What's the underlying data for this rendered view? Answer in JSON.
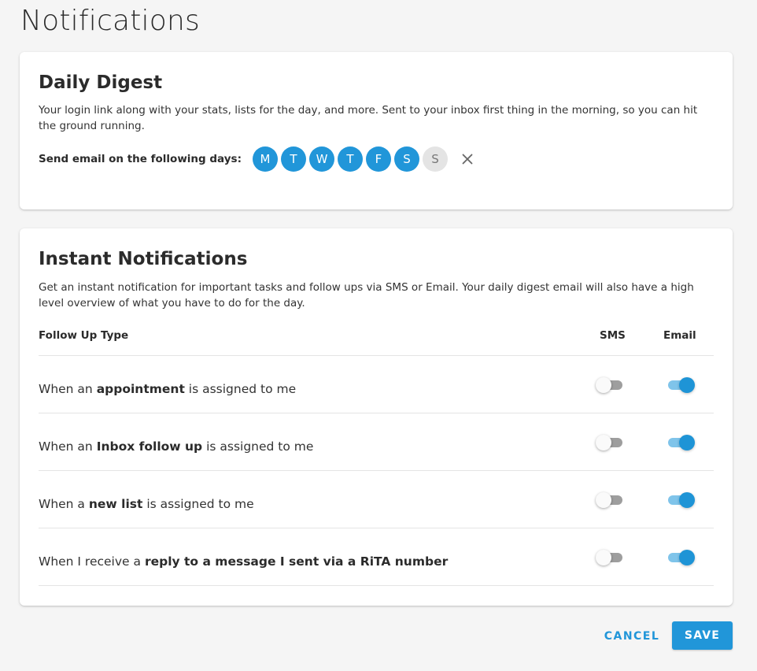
{
  "page": {
    "title": "Notifications"
  },
  "colors": {
    "accent": "#2196d9",
    "toggle_on_track": "#7fc4ea",
    "toggle_off_track": "#9e9e9e",
    "day_off": "#e4e4e4"
  },
  "digest": {
    "title": "Daily Digest",
    "description": "Your login link along with your stats, lists for the day, and more. Sent to your inbox first thing in the morning, so you can hit the ground running.",
    "days_label": "Send email on the following days:",
    "days": [
      {
        "label": "M",
        "selected": true
      },
      {
        "label": "T",
        "selected": true
      },
      {
        "label": "W",
        "selected": true
      },
      {
        "label": "T",
        "selected": true
      },
      {
        "label": "F",
        "selected": true
      },
      {
        "label": "S",
        "selected": true
      },
      {
        "label": "S",
        "selected": false
      }
    ],
    "clear_icon": "close-icon"
  },
  "instant": {
    "title": "Instant Notifications",
    "description": "Get an instant notification for important tasks and follow ups via SMS or Email. Your daily digest email will also have a high level overview of what you have to do for the day.",
    "columns": {
      "type": "Follow Up Type",
      "sms": "SMS",
      "email": "Email"
    },
    "rows": [
      {
        "prefix": "When an ",
        "bold": "appointment",
        "suffix": " is assigned to me",
        "sms": false,
        "email": true
      },
      {
        "prefix": "When an ",
        "bold": "Inbox follow up",
        "suffix": " is assigned to me",
        "sms": false,
        "email": true
      },
      {
        "prefix": "When a ",
        "bold": "new list",
        "suffix": " is assigned to me",
        "sms": false,
        "email": true
      },
      {
        "prefix": "When I receive a ",
        "bold": "reply to a message I sent via a RiTA number",
        "suffix": "",
        "sms": false,
        "email": true
      }
    ]
  },
  "actions": {
    "cancel": "CANCEL",
    "save": "SAVE"
  }
}
